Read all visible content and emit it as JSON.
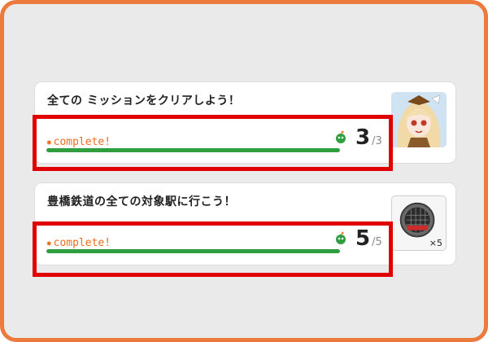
{
  "missions": [
    {
      "title": "全ての ミッションをクリアしよう！",
      "status_label": "complete!",
      "progress": {
        "current": "3",
        "total": "/3",
        "fraction": 1.0
      },
      "thumbnail": "anime-character-portrait"
    },
    {
      "title": "豊橋鉄道の全ての対象駅に行こう！",
      "status_label": "complete!",
      "progress": {
        "current": "5",
        "total": "/5",
        "fraction": 1.0
      },
      "thumbnail": "station-badge-icon",
      "quantity": "×5"
    }
  ],
  "colors": {
    "frame": "#ec7a3d",
    "highlight": "#e00000",
    "progress_fill": "#2e9e3e",
    "complete_text": "#ef6c1d"
  }
}
